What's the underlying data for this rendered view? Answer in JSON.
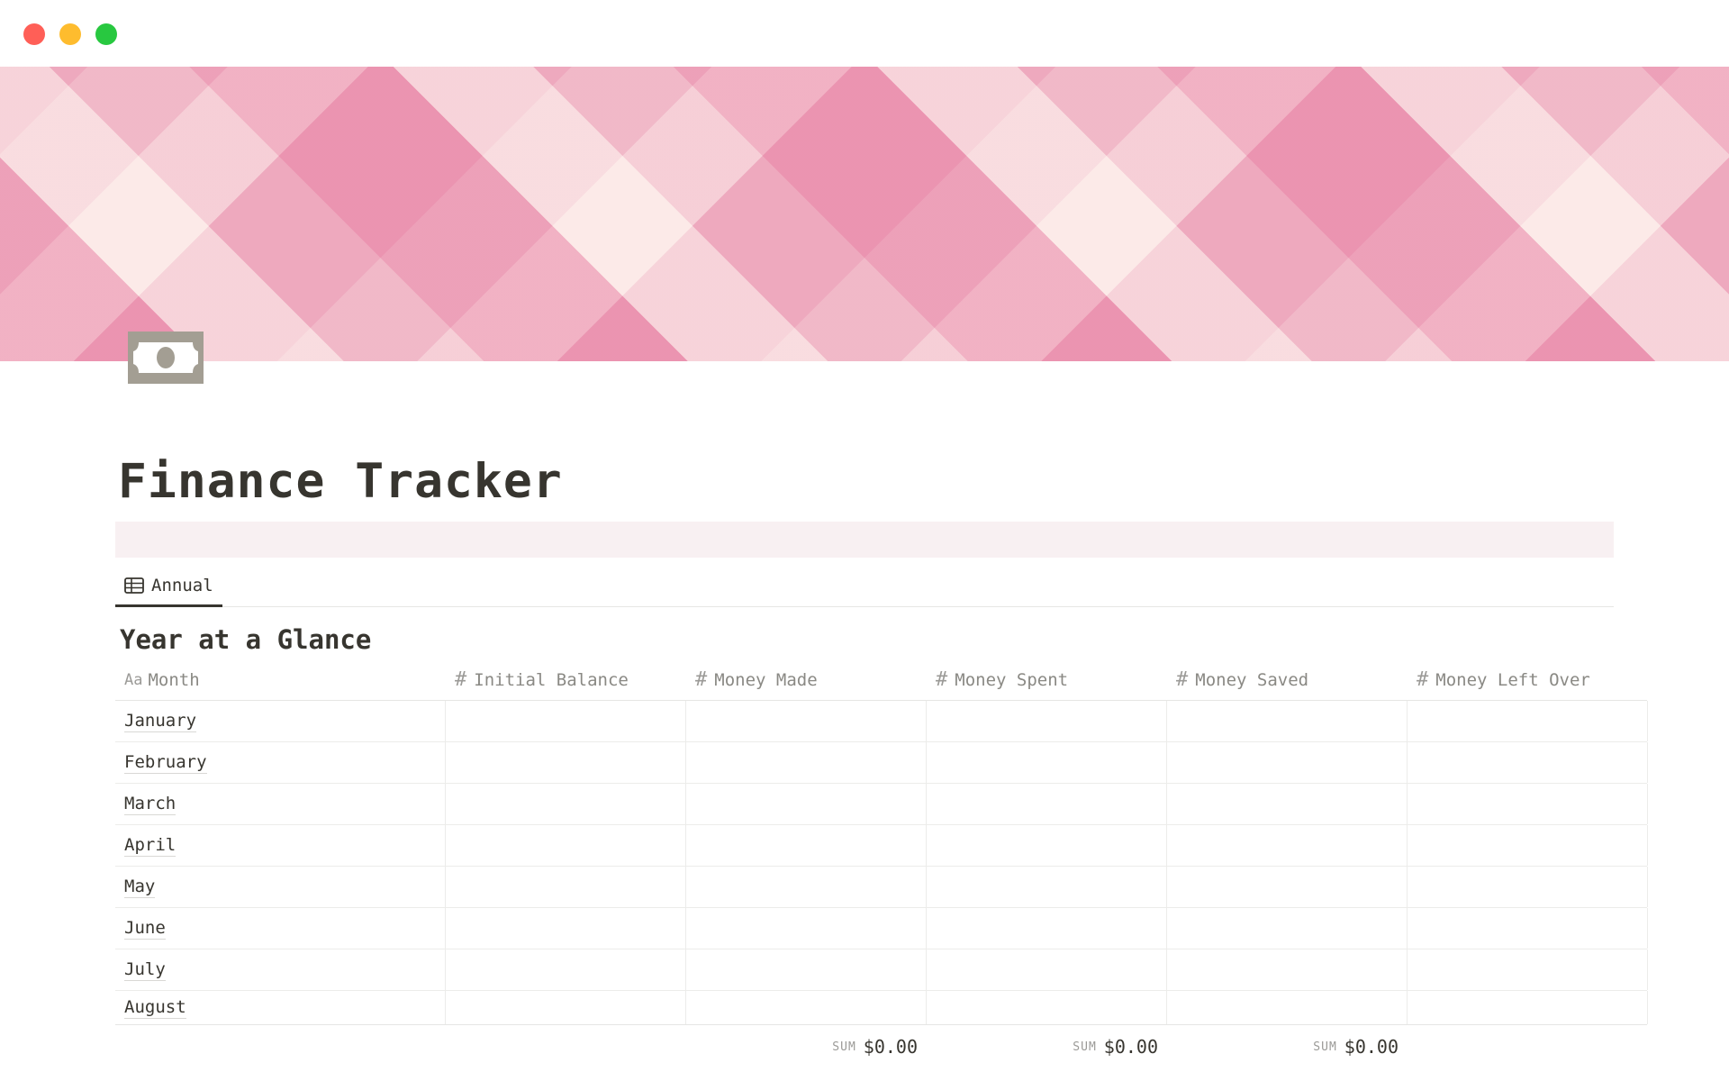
{
  "page": {
    "title": "Finance Tracker",
    "icon": "banknote-icon"
  },
  "views": [
    {
      "label": "Annual",
      "icon": "table-icon",
      "active": true
    }
  ],
  "database": {
    "title": "Year at a Glance",
    "columns": [
      {
        "label": "Month",
        "icon": "Aa"
      },
      {
        "label": "Initial Balance",
        "icon": "#"
      },
      {
        "label": "Money Made",
        "icon": "#"
      },
      {
        "label": "Money Spent",
        "icon": "#"
      },
      {
        "label": "Money Saved",
        "icon": "#"
      },
      {
        "label": "Money Left Over",
        "icon": "#"
      }
    ],
    "rows": [
      "January",
      "February",
      "March",
      "April",
      "May",
      "June",
      "July",
      "August"
    ],
    "sums": [
      {
        "label": "SUM",
        "value": "$0.00"
      },
      {
        "label": "SUM",
        "value": "$0.00"
      },
      {
        "label": "SUM",
        "value": "$0.00"
      }
    ]
  },
  "colors": {
    "text": "#37352f",
    "muted": "#9b9a97",
    "callout_bg": "#f8f0f2",
    "icon_gray": "#a39e93"
  }
}
